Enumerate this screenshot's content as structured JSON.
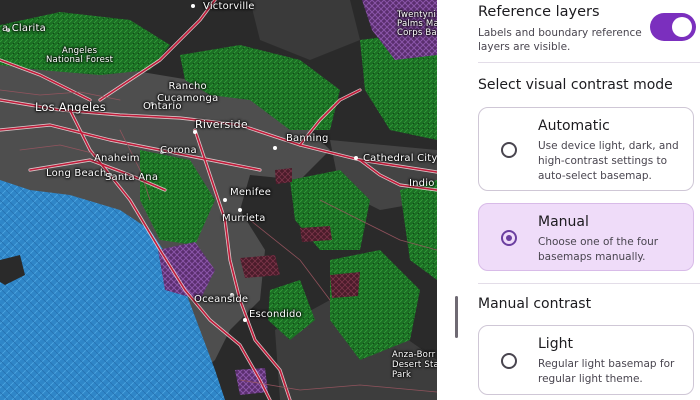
{
  "map": {
    "places": [
      {
        "id": "victorville",
        "label": "Victorville"
      },
      {
        "id": "santa-clarita",
        "label": "a Clarita"
      },
      {
        "id": "angeles-nf",
        "label": "Angeles\nNational Forest"
      },
      {
        "id": "twentynine-palms",
        "label": "Twentyni\nPalms Mar\nCorps Ba"
      },
      {
        "id": "rancho-cucamonga",
        "label": "Rancho\nCucamonga"
      },
      {
        "id": "ontario",
        "label": "Ontario"
      },
      {
        "id": "los-angeles",
        "label": "Los Angeles"
      },
      {
        "id": "riverside",
        "label": "Riverside"
      },
      {
        "id": "banning",
        "label": "Banning"
      },
      {
        "id": "corona",
        "label": "Corona"
      },
      {
        "id": "anaheim",
        "label": "Anaheim"
      },
      {
        "id": "cathedral-city",
        "label": "Cathedral City"
      },
      {
        "id": "long-beach",
        "label": "Long Beach"
      },
      {
        "id": "santa-ana",
        "label": "Santa Ana"
      },
      {
        "id": "indio",
        "label": "Indio"
      },
      {
        "id": "menifee",
        "label": "Menifee"
      },
      {
        "id": "murrieta",
        "label": "Murrieta"
      },
      {
        "id": "oceanside",
        "label": "Oceanside"
      },
      {
        "id": "escondido",
        "label": "Escondido"
      },
      {
        "id": "anza-borrego",
        "label": "Anza-Borr\nDesert Sta\nPark"
      }
    ]
  },
  "panel": {
    "reference_layers": {
      "title": "Reference layers",
      "description": "Labels and boundary reference layers are visible.",
      "enabled": true,
      "accent": "#7b2fbe"
    },
    "visual_mode": {
      "title": "Select visual contrast mode",
      "options": [
        {
          "title": "Automatic",
          "description": "Use device light, dark, and high-contrast settings to auto-select basemap.",
          "selected": false
        },
        {
          "title": "Manual",
          "description": "Choose one of the four basemaps manually.",
          "selected": true
        }
      ]
    },
    "manual_contrast": {
      "title": "Manual contrast",
      "options": [
        {
          "title": "Light",
          "description": "Regular light basemap for regular light theme.",
          "selected": false
        }
      ]
    }
  }
}
